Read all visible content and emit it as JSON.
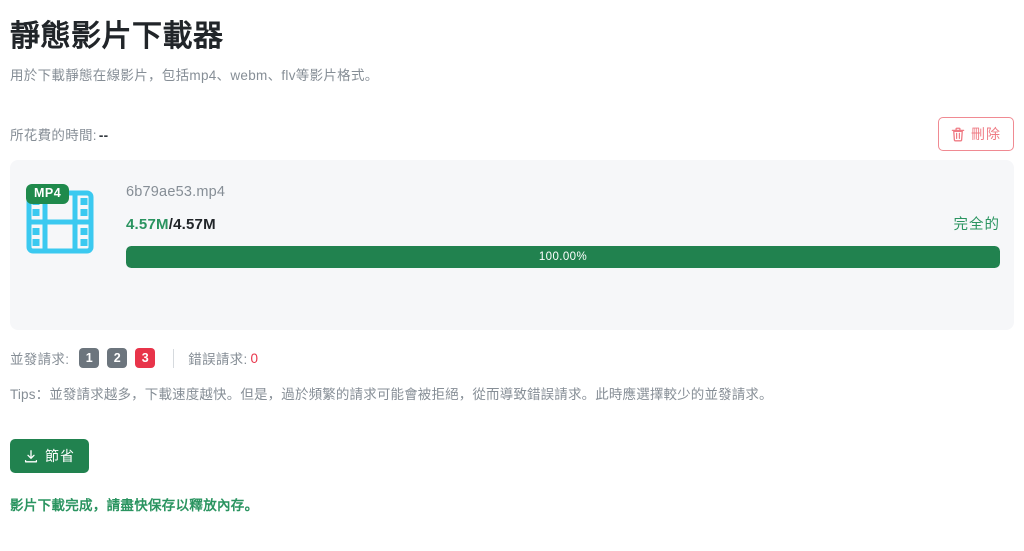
{
  "header": {
    "title": "靜態影片下載器",
    "subtitle": "用於下載靜態在線影片，包括mp4、webm、flv等影片格式。"
  },
  "meta": {
    "elapsed_label": "所花費的時間:",
    "elapsed_value": "--",
    "delete_label": "刪除",
    "delete_icon": "trash-icon"
  },
  "download": {
    "format_badge": "MP4",
    "thumbnail_icon": "film-strip-icon",
    "file_name": "6b79ae53.mp4",
    "size_current": "4.57M",
    "size_separator": "/",
    "size_total": "4.57M",
    "status": "完全的",
    "progress_text": "100.00%",
    "progress_percent": 100,
    "colors": {
      "progress_fill": "#21824f",
      "progress_track": "#e3e6e9",
      "card_background": "#f6f7f9",
      "badge_green": "#1f8a4c",
      "film_cyan": "#3bc9f0"
    }
  },
  "concurrency": {
    "label": "並發請求:",
    "options": [
      "1",
      "2",
      "3"
    ],
    "selected": "3",
    "error_label": "錯誤請求:",
    "error_count": "0",
    "colors": {
      "badge_inactive": "#6c757d",
      "badge_active": "#e8344a",
      "error_count": "#e8344a"
    }
  },
  "tips": {
    "text": "Tips：並發請求越多，下載速度越快。但是，過於頻繁的請求可能會被拒絕，從而導致錯誤請求。此時應選擇較少的並發請求。"
  },
  "actions": {
    "save_label": "節省",
    "save_icon": "download-icon"
  },
  "status_message": {
    "text": "影片下載完成，請盡快保存以釋放內存。",
    "color": "#2a9460"
  }
}
